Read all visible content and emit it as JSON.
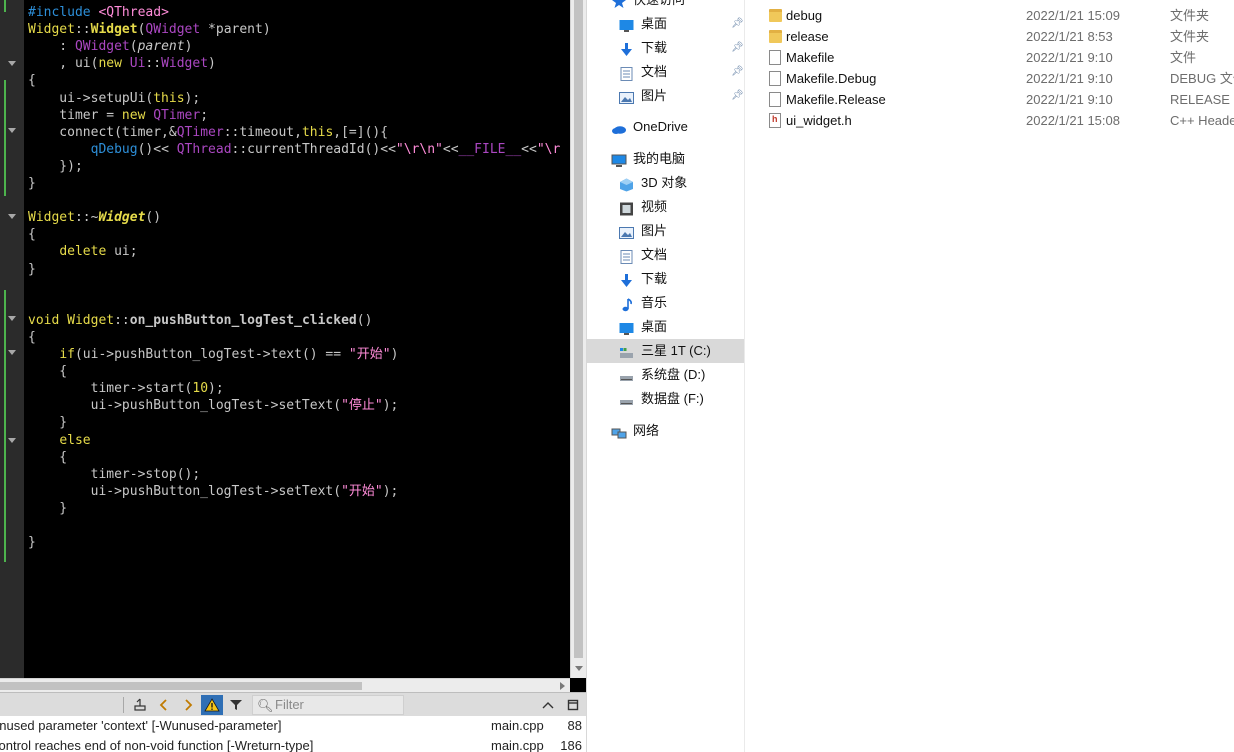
{
  "editor": {
    "lines": [
      [
        {
          "t": "#include ",
          "c": "fn"
        },
        {
          "t": "<QThread>",
          "c": "st"
        }
      ],
      [
        {
          "t": "Widget",
          "c": "cls"
        },
        {
          "t": "::",
          "c": ""
        },
        {
          "t": "Widget",
          "c": "cls bd"
        },
        {
          "t": "(",
          "c": ""
        },
        {
          "t": "QWidget",
          "c": "ty"
        },
        {
          "t": " *parent)",
          "c": ""
        }
      ],
      [
        {
          "t": "    : ",
          "c": ""
        },
        {
          "t": "QWidget",
          "c": "ty"
        },
        {
          "t": "(",
          "c": ""
        },
        {
          "t": "parent",
          "c": "it"
        },
        {
          "t": ")",
          "c": ""
        }
      ],
      [
        {
          "t": "    , ui(",
          "c": ""
        },
        {
          "t": "new",
          "c": "kw"
        },
        {
          "t": " ",
          "c": ""
        },
        {
          "t": "Ui",
          "c": "ty"
        },
        {
          "t": "::",
          "c": ""
        },
        {
          "t": "Widget",
          "c": "ty"
        },
        {
          "t": ")",
          "c": ""
        }
      ],
      [
        {
          "t": "{",
          "c": ""
        }
      ],
      [
        {
          "t": "    ui->setupUi(",
          "c": ""
        },
        {
          "t": "this",
          "c": "kw"
        },
        {
          "t": ");",
          "c": ""
        }
      ],
      [
        {
          "t": "    timer = ",
          "c": ""
        },
        {
          "t": "new",
          "c": "kw"
        },
        {
          "t": " ",
          "c": ""
        },
        {
          "t": "QTimer",
          "c": "ty"
        },
        {
          "t": ";",
          "c": ""
        }
      ],
      [
        {
          "t": "    connect(timer,&",
          "c": ""
        },
        {
          "t": "QTimer",
          "c": "ty"
        },
        {
          "t": "::timeout,",
          "c": ""
        },
        {
          "t": "this",
          "c": "kw"
        },
        {
          "t": ",[=](){",
          "c": ""
        }
      ],
      [
        {
          "t": "        ",
          "c": ""
        },
        {
          "t": "qDebug",
          "c": "fn"
        },
        {
          "t": "()<< ",
          "c": ""
        },
        {
          "t": "QThread",
          "c": "ty"
        },
        {
          "t": "::currentThreadId()<<",
          "c": ""
        },
        {
          "t": "\"\\r\\n\"",
          "c": "st"
        },
        {
          "t": "<<",
          "c": ""
        },
        {
          "t": "__FILE__",
          "c": "mac"
        },
        {
          "t": "<<",
          "c": ""
        },
        {
          "t": "\"\\r",
          "c": "st"
        }
      ],
      [
        {
          "t": "    });",
          "c": ""
        }
      ],
      [
        {
          "t": "}",
          "c": ""
        }
      ],
      [
        {
          "t": "",
          "c": ""
        }
      ],
      [
        {
          "t": "Widget",
          "c": "cls"
        },
        {
          "t": "::~",
          "c": ""
        },
        {
          "t": "Widget",
          "c": "cls bd it"
        },
        {
          "t": "()",
          "c": ""
        }
      ],
      [
        {
          "t": "{",
          "c": ""
        }
      ],
      [
        {
          "t": "    ",
          "c": ""
        },
        {
          "t": "delete",
          "c": "kw"
        },
        {
          "t": " ui;",
          "c": ""
        }
      ],
      [
        {
          "t": "}",
          "c": ""
        }
      ],
      [
        {
          "t": "",
          "c": ""
        }
      ],
      [
        {
          "t": "",
          "c": ""
        }
      ],
      [
        {
          "t": "void",
          "c": "kw"
        },
        {
          "t": " ",
          "c": ""
        },
        {
          "t": "Widget",
          "c": "cls"
        },
        {
          "t": "::",
          "c": ""
        },
        {
          "t": "on_pushButton_logTest_clicked",
          "c": "bd"
        },
        {
          "t": "()",
          "c": ""
        }
      ],
      [
        {
          "t": "{",
          "c": ""
        }
      ],
      [
        {
          "t": "    ",
          "c": ""
        },
        {
          "t": "if",
          "c": "kw"
        },
        {
          "t": "(ui->pushButton_logTest->text() == ",
          "c": ""
        },
        {
          "t": "\"开始\"",
          "c": "st"
        },
        {
          "t": ")",
          "c": ""
        }
      ],
      [
        {
          "t": "    {",
          "c": ""
        }
      ],
      [
        {
          "t": "        timer->start(",
          "c": ""
        },
        {
          "t": "10",
          "c": "kw"
        },
        {
          "t": ");",
          "c": ""
        }
      ],
      [
        {
          "t": "        ui->pushButton_logTest->setText(",
          "c": ""
        },
        {
          "t": "\"停止\"",
          "c": "st"
        },
        {
          "t": ");",
          "c": ""
        }
      ],
      [
        {
          "t": "    }",
          "c": ""
        }
      ],
      [
        {
          "t": "    ",
          "c": ""
        },
        {
          "t": "else",
          "c": "kw"
        }
      ],
      [
        {
          "t": "    {",
          "c": ""
        }
      ],
      [
        {
          "t": "        timer->stop();",
          "c": ""
        }
      ],
      [
        {
          "t": "        ui->pushButton_logTest->setText(",
          "c": ""
        },
        {
          "t": "\"开始\"",
          "c": "st"
        },
        {
          "t": ");",
          "c": ""
        }
      ],
      [
        {
          "t": "    }",
          "c": ""
        }
      ],
      [
        {
          "t": "",
          "c": ""
        }
      ],
      [
        {
          "t": "}",
          "c": ""
        }
      ]
    ]
  },
  "issues_toolbar": {
    "filter_placeholder": "Filter",
    "prev_icon": "chevron-left-icon",
    "next_icon": "chevron-right-icon",
    "warning_icon": "warning-icon",
    "filter_icon": "funnel-icon"
  },
  "issues": [
    {
      "message": "unused parameter 'context' [-Wunused-parameter]",
      "file": "main.cpp",
      "line": "88"
    },
    {
      "message": "control reaches end of non-void function [-Wreturn-type]",
      "file": "main.cpp",
      "line": "186"
    }
  ],
  "explorer": {
    "nav": {
      "quick_access": "快速访问",
      "quick_items": [
        {
          "label": "桌面",
          "icon": "desktop-icon"
        },
        {
          "label": "下载",
          "icon": "download-icon"
        },
        {
          "label": "文档",
          "icon": "document-icon"
        },
        {
          "label": "图片",
          "icon": "pictures-icon"
        }
      ],
      "onedrive": "OneDrive",
      "this_pc": "我的电脑",
      "pc_items": [
        {
          "label": "3D 对象",
          "icon": "3d-objects-icon"
        },
        {
          "label": "视频",
          "icon": "video-icon"
        },
        {
          "label": "图片",
          "icon": "pictures-icon"
        },
        {
          "label": "文档",
          "icon": "document-icon"
        },
        {
          "label": "下载",
          "icon": "download-icon"
        },
        {
          "label": "音乐",
          "icon": "music-icon"
        },
        {
          "label": "桌面",
          "icon": "desktop-icon"
        },
        {
          "label": "三星 1T (C:)",
          "icon": "drive-c-icon",
          "selected": true
        },
        {
          "label": "系统盘 (D:)",
          "icon": "drive-icon"
        },
        {
          "label": "数据盘 (F:)",
          "icon": "drive-icon"
        }
      ],
      "network": "网络"
    },
    "files": [
      {
        "name": "debug",
        "date": "2022/1/21 15:09",
        "type": "文件夹",
        "kind": "folder"
      },
      {
        "name": "release",
        "date": "2022/1/21 8:53",
        "type": "文件夹",
        "kind": "folder"
      },
      {
        "name": "Makefile",
        "date": "2022/1/21 9:10",
        "type": "文件",
        "kind": "doc"
      },
      {
        "name": "Makefile.Debug",
        "date": "2022/1/21 9:10",
        "type": "DEBUG 文件",
        "kind": "doc"
      },
      {
        "name": "Makefile.Release",
        "date": "2022/1/21 9:10",
        "type": "RELEASE 文件",
        "kind": "doc"
      },
      {
        "name": "ui_widget.h",
        "date": "2022/1/21 15:08",
        "type": "C++ Header",
        "kind": "header"
      }
    ]
  }
}
